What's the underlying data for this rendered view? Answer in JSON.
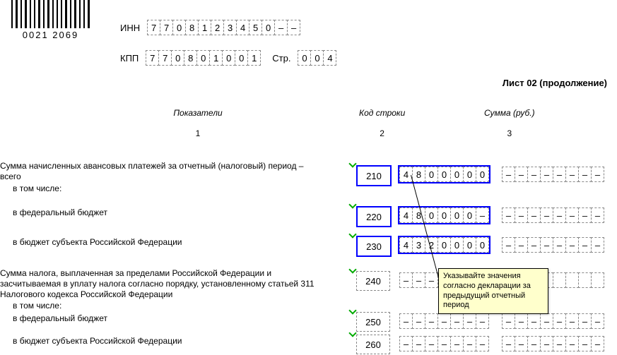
{
  "barcode_number": "0021 2069",
  "header": {
    "inn_label": "ИНН",
    "inn": [
      "7",
      "7",
      "0",
      "8",
      "1",
      "2",
      "3",
      "4",
      "5",
      "0",
      "–",
      "–"
    ],
    "kpp_label": "КПП",
    "kpp": [
      "7",
      "7",
      "0",
      "8",
      "0",
      "1",
      "0",
      "0",
      "1"
    ],
    "page_label": "Стр.",
    "page": [
      "0",
      "0",
      "4"
    ]
  },
  "sheet_title": "Лист 02 (продолжение)",
  "columns": {
    "c1_head": "Показатели",
    "c1_num": "1",
    "c2_head": "Код строки",
    "c2_num": "2",
    "c3_head": "Сумма (руб.)",
    "c3_num": "3"
  },
  "rows": [
    {
      "label": "Сумма начисленных авансовых платежей за отчетный (налоговый) период – всего",
      "sub": "в том числе:",
      "code": "210",
      "sum1": [
        "4",
        "8",
        "0",
        "0",
        "0",
        "0",
        "0"
      ],
      "sum2": [
        "–",
        "–",
        "–",
        "–",
        "–",
        "–",
        "–",
        "–"
      ],
      "highlight": true
    },
    {
      "label": "в федеральный бюджет",
      "code": "220",
      "sum1": [
        "4",
        "8",
        "0",
        "0",
        "0",
        "0",
        "–"
      ],
      "sum2": [
        "–",
        "–",
        "–",
        "–",
        "–",
        "–",
        "–",
        "–"
      ],
      "highlight": true
    },
    {
      "label": "в бюджет субъекта Российской Федерации",
      "code": "230",
      "sum1": [
        "4",
        "3",
        "2",
        "0",
        "0",
        "0",
        "0"
      ],
      "sum2": [
        "–",
        "–",
        "–",
        "–",
        "–",
        "–",
        "–",
        "–"
      ],
      "highlight": true
    },
    {
      "label": "Сумма налога, выплаченная за пределами Российской Федерации и засчитываемая в уплату налога согласно порядку, установленному статьей 311 Налогового кодекса Российской Федерации",
      "sub": "в том числе:",
      "code": "240",
      "sum1": [
        "–",
        "–",
        "–",
        "–",
        "–",
        "–",
        "–"
      ],
      "sum2": [
        "",
        "",
        "",
        "",
        "",
        "",
        "",
        ""
      ],
      "highlight": false
    },
    {
      "label": "в федеральный бюджет",
      "code": "250",
      "sum1": [
        "–",
        "–",
        "–",
        "–",
        "–",
        "–",
        "–"
      ],
      "sum2": [
        "–",
        "–",
        "–",
        "–",
        "–",
        "–",
        "–",
        "–"
      ],
      "highlight": false
    },
    {
      "label": "в бюджет субъекта Российской Федерации",
      "code": "260",
      "sum1": [
        "–",
        "–",
        "–",
        "–",
        "–",
        "–",
        "–"
      ],
      "sum2": [
        "–",
        "–",
        "–",
        "–",
        "–",
        "–",
        "–",
        "–"
      ],
      "highlight": false
    }
  ],
  "tooltip_text": "Указывайте значения согласно декларации за предыдущий отчетный период"
}
